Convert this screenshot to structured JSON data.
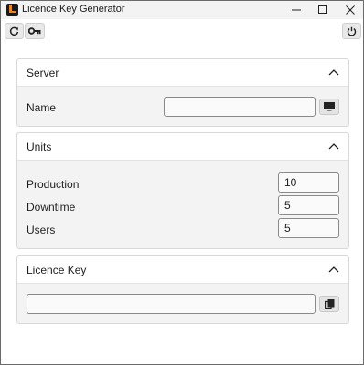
{
  "window": {
    "title": "Licence Key Generator"
  },
  "toolbar": {
    "buttons": [
      {
        "icon": "refresh-icon"
      },
      {
        "icon": "key-icon"
      },
      {
        "icon": "power-icon"
      }
    ]
  },
  "server": {
    "title": "Server",
    "name_label": "Name",
    "name_value": "",
    "browse_icon": "monitor-icon"
  },
  "units": {
    "title": "Units",
    "production_label": "Production",
    "production_value": "10",
    "downtime_label": "Downtime",
    "downtime_value": "5",
    "users_label": "Users",
    "users_value": "5"
  },
  "licence": {
    "title": "Licence Key",
    "key_value": "",
    "copy_icon": "copy-icon"
  },
  "colors": {
    "titlebar_bg": "#f3f3f3",
    "panel_bg": "#f3f3f3",
    "panel_header_bg": "#ffffff",
    "app_icon_accent": "#e8862a"
  }
}
